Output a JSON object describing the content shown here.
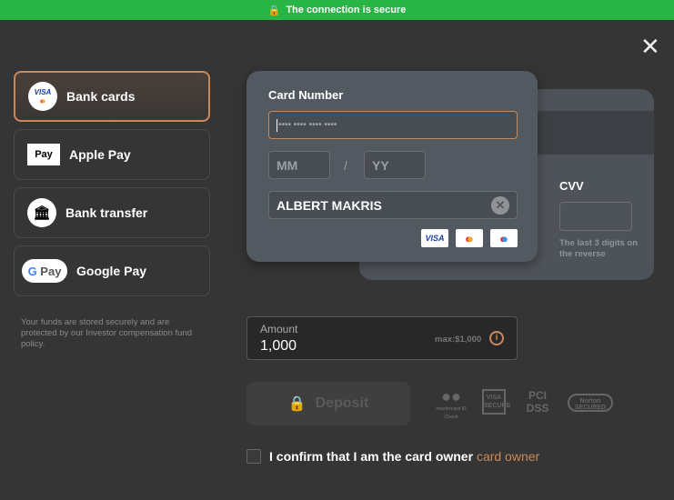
{
  "security_bar": {
    "text": "The connection is secure",
    "icon": "shield-lock-icon",
    "color": "#29b446"
  },
  "close_icon": "close-icon",
  "methods": [
    {
      "label": "Bank cards",
      "icon": "visa-mastercard-icon",
      "active": true
    },
    {
      "label": "Apple Pay",
      "icon": "apple-pay-icon"
    },
    {
      "label": "Bank transfer",
      "icon": "bank-icon"
    },
    {
      "label": "Google Pay",
      "icon": "google-pay-icon"
    }
  ],
  "note": "Your funds are stored securely and are protected by our Investor compensation fund policy.",
  "card": {
    "number_label": "Card Number",
    "number_placeholder": "•••• •••• •••• ••••",
    "month_placeholder": "MM",
    "separator": "/",
    "year_placeholder": "YY",
    "holder": "ALBERT MAKRIS",
    "brands": [
      "VISA",
      "Mastercard",
      "Maestro"
    ],
    "cvv_label": "CVV",
    "cvv_hint": "The last 3 digits on the reverse"
  },
  "amount": {
    "label": "Amount",
    "value": "1,000",
    "max": "max:$1,000"
  },
  "deposit_label": "Deposit",
  "trust_badges": [
    "mastercard ID Check",
    "VISA SECURE",
    "PCI DSS",
    "Norton SECURED"
  ],
  "confirm": {
    "text": "I confirm that I am the card owner",
    "link": "card owner"
  },
  "accent": "#c8895a"
}
